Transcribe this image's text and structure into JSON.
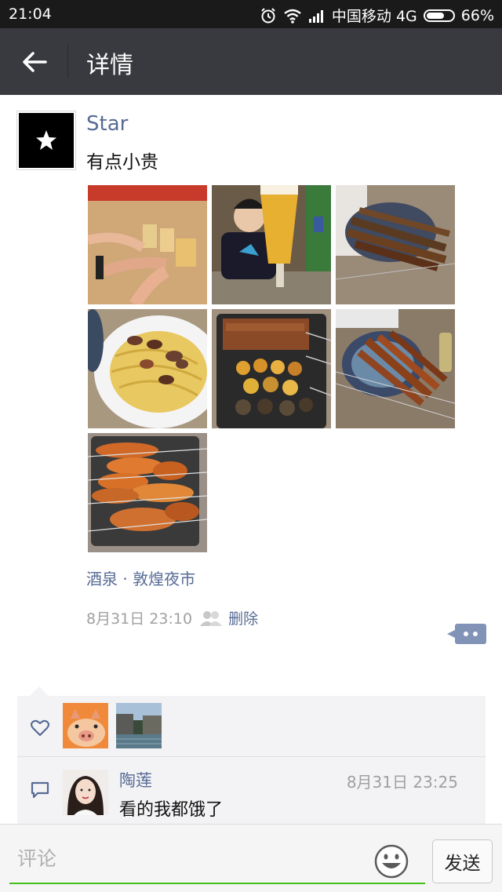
{
  "status_bar": {
    "time": "21:04",
    "carrier": "中国移动 4G",
    "battery": "66%",
    "battery_level": 0.66,
    "icons": [
      "alarm-icon",
      "wifi-icon",
      "signal-icon",
      "battery-icon"
    ]
  },
  "header": {
    "title": "详情",
    "back_icon": "arrow-left-icon",
    "background": "#393a3f"
  },
  "post": {
    "author": "Star",
    "text": "有点小贵",
    "photos": [
      {
        "name": "toast-beer-photo",
        "palette": [
          "#c48a55",
          "#e8c58a",
          "#8b5a3a"
        ]
      },
      {
        "name": "man-with-beer-photo",
        "palette": [
          "#5a4a3a",
          "#e8b43a",
          "#2a2a2a"
        ]
      },
      {
        "name": "skewers-plate-photo",
        "palette": [
          "#8a7a6a",
          "#5a3a20",
          "#c0b0a0"
        ]
      },
      {
        "name": "noodles-photo",
        "palette": [
          "#e0c060",
          "#8a5030",
          "#f0f0f0"
        ]
      },
      {
        "name": "grill-tray-photo",
        "palette": [
          "#3a3a3a",
          "#c07030",
          "#e0b040"
        ]
      },
      {
        "name": "lamb-skewers-photo",
        "palette": [
          "#7a6a5a",
          "#a05020",
          "#c09070"
        ]
      },
      {
        "name": "chicken-wings-photo",
        "palette": [
          "#c06020",
          "#e08040",
          "#4a4a4a"
        ]
      }
    ],
    "location": "酒泉 · 敦煌夜市",
    "time": "8月31日 23:10",
    "delete_label": "删除",
    "link_color": "#576b95"
  },
  "likes": {
    "icon": "heart-icon",
    "avatars": [
      {
        "name": "like-avatar-pig",
        "colors": [
          "#f08a3a",
          "#f5c7a0"
        ]
      },
      {
        "name": "like-avatar-canal",
        "colors": [
          "#7a9ab8",
          "#5a6a5a"
        ]
      }
    ]
  },
  "comments": [
    {
      "author": "陶莲",
      "time": "8月31日 23:25",
      "text": "看的我都饿了"
    }
  ],
  "comment_bar": {
    "placeholder": "评论",
    "send_label": "发送",
    "accent": "#45c01a"
  }
}
